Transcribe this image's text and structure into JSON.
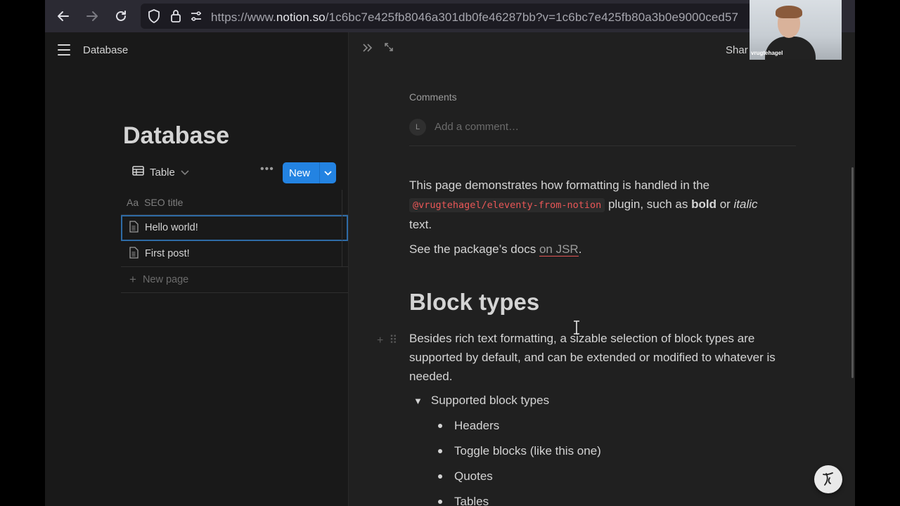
{
  "browser": {
    "url_prefix": "https://www.",
    "url_domain": "notion.so",
    "url_rest": "/1c6bc7e425fb8046a301db0fe46287bb?v=1c6bc7e425fb80a3b0e9000ced57"
  },
  "webcam": {
    "name_label": "vrugtehagel"
  },
  "left": {
    "breadcrumb": "Database",
    "title": "Database",
    "view_label": "Table",
    "new_label": "New",
    "column_header": "SEO title",
    "column_type": "Aa",
    "rows": [
      {
        "title": "Hello world!"
      },
      {
        "title": "First post!"
      }
    ],
    "new_page_label": "New page"
  },
  "right": {
    "share_label": "Shar",
    "comments_label": "Comments",
    "avatar_initial": "L",
    "comment_placeholder": "Add a comment…",
    "para1_a": "This page demonstrates how formatting is handled in the",
    "para1_code": "@vrugtehagel/eleventy-from-notion",
    "para1_b": " plugin, such as ",
    "para1_bold": "bold",
    "para1_c": " or ",
    "para1_italic": "italic",
    "para1_d": "text.",
    "para2_a": "See the package’s docs ",
    "para2_link": "on JSR",
    "para2_b": ".",
    "heading": "Block types",
    "para3": "Besides rich text formatting, a sizable selection of block types are supported by default, and can be extended or modified to whatever is needed.",
    "toggle_label": "Supported block types",
    "bullets": [
      "Headers",
      "Toggle blocks (like this one)",
      "Quotes",
      "Tables"
    ]
  },
  "colors": {
    "accent": "#2383e2",
    "code": "#eb5757",
    "background": "#191919",
    "peek_background": "#202020"
  },
  "icons": [
    "back-icon",
    "forward-icon",
    "reload-icon",
    "shield-icon",
    "lock-icon",
    "permissions-icon",
    "menu-icon",
    "table-icon",
    "chevron-down-icon",
    "more-icon",
    "page-icon",
    "plus-icon",
    "collapse-peek-icon",
    "expand-icon",
    "help-icon"
  ]
}
